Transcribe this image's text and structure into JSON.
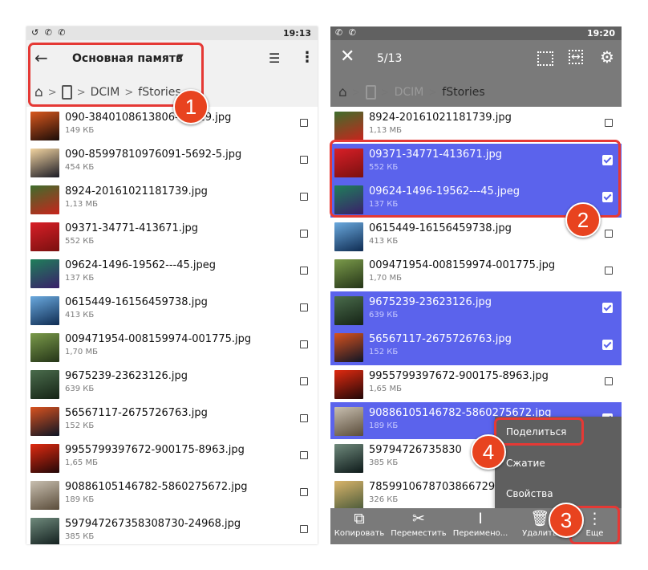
{
  "left": {
    "status": {
      "icons": "↺ ✆ ✆",
      "time": "19:13"
    },
    "header": {
      "title": "Основная память",
      "view_icon": "☰",
      "menu_icon": "⋮"
    },
    "breadcrumb": [
      "DCIM",
      "fStories"
    ],
    "files": [
      {
        "name": "090-3840108613806-11029.jpg",
        "size": "149 КБ",
        "colors": [
          "#d9581e",
          "#1a0c08"
        ]
      },
      {
        "name": "090-85997810976091-5692-5.jpg",
        "size": "454 КБ",
        "colors": [
          "#f2d4a0",
          "#1b1b26"
        ]
      },
      {
        "name": "8924-20161021181739.jpg",
        "size": "1,13 МБ",
        "colors": [
          "#3e6e2c",
          "#c8241c"
        ]
      },
      {
        "name": "09371-34771-413671.jpg",
        "size": "552 КБ",
        "colors": [
          "#d81f27",
          "#7a1010"
        ]
      },
      {
        "name": "09624-1496-19562---45.jpeg",
        "size": "137 КБ",
        "colors": [
          "#1f7f5a",
          "#3a1f6a"
        ]
      },
      {
        "name": "0615449-16156459738.jpg",
        "size": "413 КБ",
        "colors": [
          "#6aa9de",
          "#0f2c52"
        ]
      },
      {
        "name": "009471954-008159974-001775.jpg",
        "size": "1,70 МБ",
        "colors": [
          "#7a9a4a",
          "#253518"
        ]
      },
      {
        "name": "9675239-23623126.jpg",
        "size": "639 КБ",
        "colors": [
          "#4a6c4c",
          "#152315"
        ]
      },
      {
        "name": "56567117-2675726763.jpg",
        "size": "152 КБ",
        "colors": [
          "#d8521e",
          "#0e1525"
        ]
      },
      {
        "name": "9955799397672-900175-8963.jpg",
        "size": "1,65 МБ",
        "colors": [
          "#e02a10",
          "#230808"
        ]
      },
      {
        "name": "90886105146782-5860275672.jpg",
        "size": "189 КБ",
        "colors": [
          "#c8bfb0",
          "#5a4c3a"
        ]
      },
      {
        "name": "597947267358308730-24968.jpg",
        "size": "385 КБ",
        "colors": [
          "#6f8a7c",
          "#0e1a1a"
        ]
      }
    ]
  },
  "right": {
    "status": {
      "icons": "✆ ✆",
      "time": "19:20"
    },
    "header": {
      "count": "5/13",
      "close_icon": "✕",
      "settings_icon": "⚙",
      "range_icon": "↔"
    },
    "breadcrumb": [
      "DCIM",
      "fStories"
    ],
    "files": [
      {
        "name": "8924-20161021181739.jpg",
        "size": "1,13 МБ",
        "selected": false,
        "colors": [
          "#3e6e2c",
          "#c8241c"
        ]
      },
      {
        "name": "09371-34771-413671.jpg",
        "size": "552 КБ",
        "selected": true,
        "colors": [
          "#d81f27",
          "#7a1010"
        ]
      },
      {
        "name": "09624-1496-19562---45.jpeg",
        "size": "137 КБ",
        "selected": true,
        "colors": [
          "#1f7f5a",
          "#3a1f6a"
        ]
      },
      {
        "name": "0615449-16156459738.jpg",
        "size": "413 КБ",
        "selected": false,
        "colors": [
          "#6aa9de",
          "#0f2c52"
        ]
      },
      {
        "name": "009471954-008159974-001775.jpg",
        "size": "1,70 МБ",
        "selected": false,
        "colors": [
          "#7a9a4a",
          "#253518"
        ]
      },
      {
        "name": "9675239-23623126.jpg",
        "size": "639 КБ",
        "selected": true,
        "colors": [
          "#4a6c4c",
          "#152315"
        ]
      },
      {
        "name": "56567117-2675726763.jpg",
        "size": "152 КБ",
        "selected": true,
        "colors": [
          "#d8521e",
          "#0e1525"
        ]
      },
      {
        "name": "9955799397672-900175-8963.jpg",
        "size": "1,65 МБ",
        "selected": false,
        "colors": [
          "#e02a10",
          "#230808"
        ]
      },
      {
        "name": "90886105146782-5860275672.jpg",
        "size": "189 КБ",
        "selected": true,
        "colors": [
          "#c8bfb0",
          "#5a4c3a"
        ]
      },
      {
        "name": "59794726735830",
        "size": "385 КБ",
        "selected": false,
        "colors": [
          "#6f8a7c",
          "#0e1a1a"
        ]
      },
      {
        "name": "78599106787038667293",
        "size": "326 КБ",
        "selected": false,
        "colors": [
          "#d9b46a",
          "#4a5a3a"
        ]
      }
    ],
    "popup": {
      "items": [
        "Поделиться",
        "Сжатие",
        "Свойства"
      ]
    },
    "bottombar": [
      {
        "icon": "⧉",
        "label": "Копировать",
        "icon_name": "copy-icon"
      },
      {
        "icon": "✂",
        "label": "Переместить",
        "icon_name": "scissors-icon"
      },
      {
        "icon": "I",
        "label": "Переимено...",
        "icon_name": "rename-icon"
      },
      {
        "icon": "🗑",
        "label": "Удалить",
        "icon_name": "trash-icon"
      },
      {
        "icon": "⋮",
        "label": "Еще",
        "icon_name": "more-icon"
      }
    ]
  },
  "callouts": [
    "1",
    "2",
    "3",
    "4"
  ],
  "colors": {
    "selection": "#5b63ec",
    "highlight": "#e53935",
    "badge": "#e8431f"
  }
}
